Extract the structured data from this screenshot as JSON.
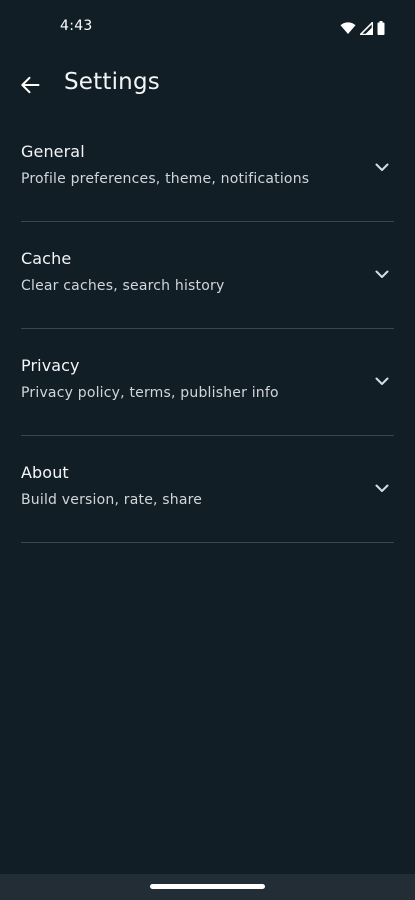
{
  "status_bar": {
    "time": "4:43",
    "icons": [
      "wifi-icon",
      "signal-icon",
      "battery-icon"
    ]
  },
  "header": {
    "back_icon": "arrow-left-icon",
    "title": "Settings"
  },
  "settings": {
    "items": [
      {
        "title": "General",
        "subtitle": "Profile preferences, theme, notifications",
        "icon": "chevron-down-icon"
      },
      {
        "title": "Cache",
        "subtitle": "Clear caches, search history",
        "icon": "chevron-down-icon"
      },
      {
        "title": "Privacy",
        "subtitle": "Privacy policy, terms, publisher info",
        "icon": "chevron-down-icon"
      },
      {
        "title": "About",
        "subtitle": "Build version, rate, share",
        "icon": "chevron-down-icon"
      }
    ]
  },
  "colors": {
    "background": "#121e26",
    "divider": "#3b474f",
    "nav_bar": "#222d35",
    "text_primary": "#f4f6f8",
    "text_secondary": "#d0d6da"
  }
}
